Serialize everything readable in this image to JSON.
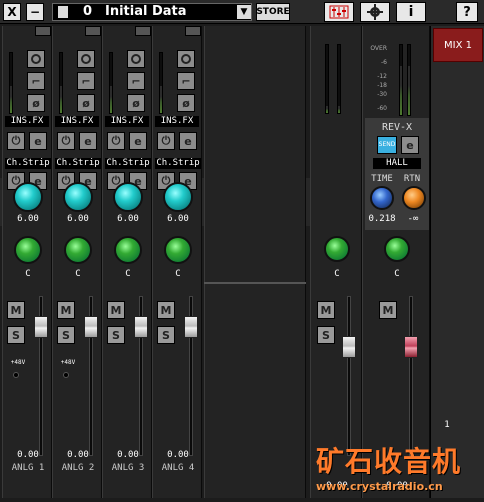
{
  "topbar": {
    "close_label": "X",
    "minimize_label": "−",
    "scene_number": "0",
    "scene_title": "Initial Data",
    "dropdown_glyph": "▼",
    "store_label": "STORE",
    "mixer_icon": "fader-icon",
    "settings_icon": "gear-icon",
    "info_label": "i",
    "help_label": "?"
  },
  "channels": [
    {
      "name": "ANLG 1",
      "insert": "INS.FX",
      "strip": "Ch.Strip",
      "gain": "6.00",
      "pan": "C",
      "level": "0.00",
      "phantom": "+48V"
    },
    {
      "name": "ANLG 2",
      "insert": "INS.FX",
      "strip": "Ch.Strip",
      "gain": "6.00",
      "pan": "C",
      "level": "0.00",
      "phantom": "+48V"
    },
    {
      "name": "ANLG 3",
      "insert": "INS.FX",
      "strip": "Ch.Strip",
      "gain": "6.00",
      "pan": "C",
      "level": "0.00"
    },
    {
      "name": "ANLG 4",
      "insert": "INS.FX",
      "strip": "Ch.Strip",
      "gain": "6.00",
      "pan": "C",
      "level": "0.00"
    }
  ],
  "buttons": {
    "mute": "M",
    "solo": "S",
    "edit": "e",
    "power": "⏻"
  },
  "daw_strip": {
    "pan": "C",
    "level": "0.00"
  },
  "master": {
    "meter_scale": [
      "OVER",
      "-6",
      "-12",
      "-18",
      "-30",
      "-60"
    ],
    "reverb_title": "REV-X",
    "reverb_send_label": "SEND",
    "reverb_type": "HALL",
    "time_label": "TIME",
    "rtn_label": "RTN",
    "time_value": "0.218",
    "rtn_value": "-∞",
    "pan": "C",
    "level": "0.00"
  },
  "mix_tab": {
    "label": "MIX 1"
  },
  "side_number": "1",
  "watermark": {
    "title": "矿石收音机",
    "url": "www.crystalradio.cn"
  },
  "colors": {
    "accent_red": "#8a1c1c",
    "knob_cyan": "#22c4c4",
    "knob_green": "#2e9a2e"
  }
}
